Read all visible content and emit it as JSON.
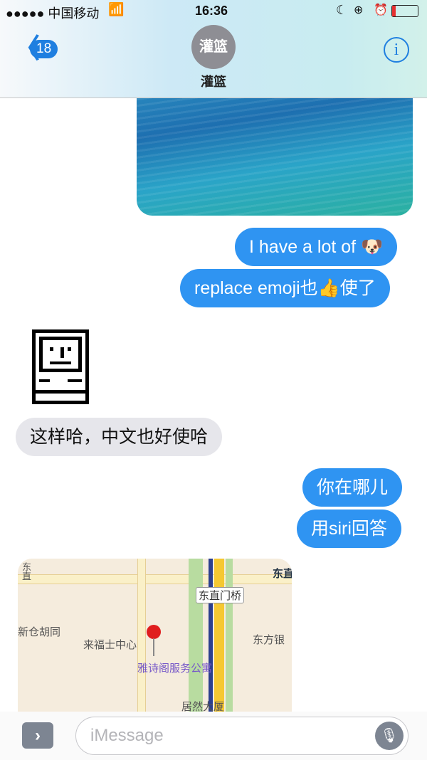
{
  "status": {
    "carrier": "●●●●● 中国移动",
    "time": "16:36",
    "battery_level": 0.15
  },
  "header": {
    "back_count": "18",
    "avatar_initials": "灌篮",
    "contact_name": "灌篮"
  },
  "messages": [
    {
      "type": "image",
      "direction": "outgoing"
    },
    {
      "type": "text",
      "direction": "outgoing",
      "text": "I have a lot of 🐶"
    },
    {
      "type": "text",
      "direction": "outgoing",
      "text": "replace emoji也👍使了"
    },
    {
      "type": "sticker",
      "direction": "incoming",
      "icon": "happy-mac-icon"
    },
    {
      "type": "text",
      "direction": "incoming",
      "text": "这样哈，中文也好使哈"
    },
    {
      "type": "text",
      "direction": "outgoing",
      "text": "你在哪儿"
    },
    {
      "type": "text",
      "direction": "outgoing",
      "text": "用siri回答"
    },
    {
      "type": "map",
      "direction": "incoming"
    }
  ],
  "map_labels": {
    "bridge": "东直门桥",
    "hutong": "新仓胡同",
    "mall": "来福士中心",
    "hotel": "雅诗阁服务公寓",
    "bank": "东方银",
    "building": "居然大厦",
    "corner": "东直",
    "street": "东直"
  },
  "input": {
    "placeholder": "iMessage"
  },
  "colors": {
    "accent": "#2f94f2",
    "incoming": "#e6e6eb"
  }
}
